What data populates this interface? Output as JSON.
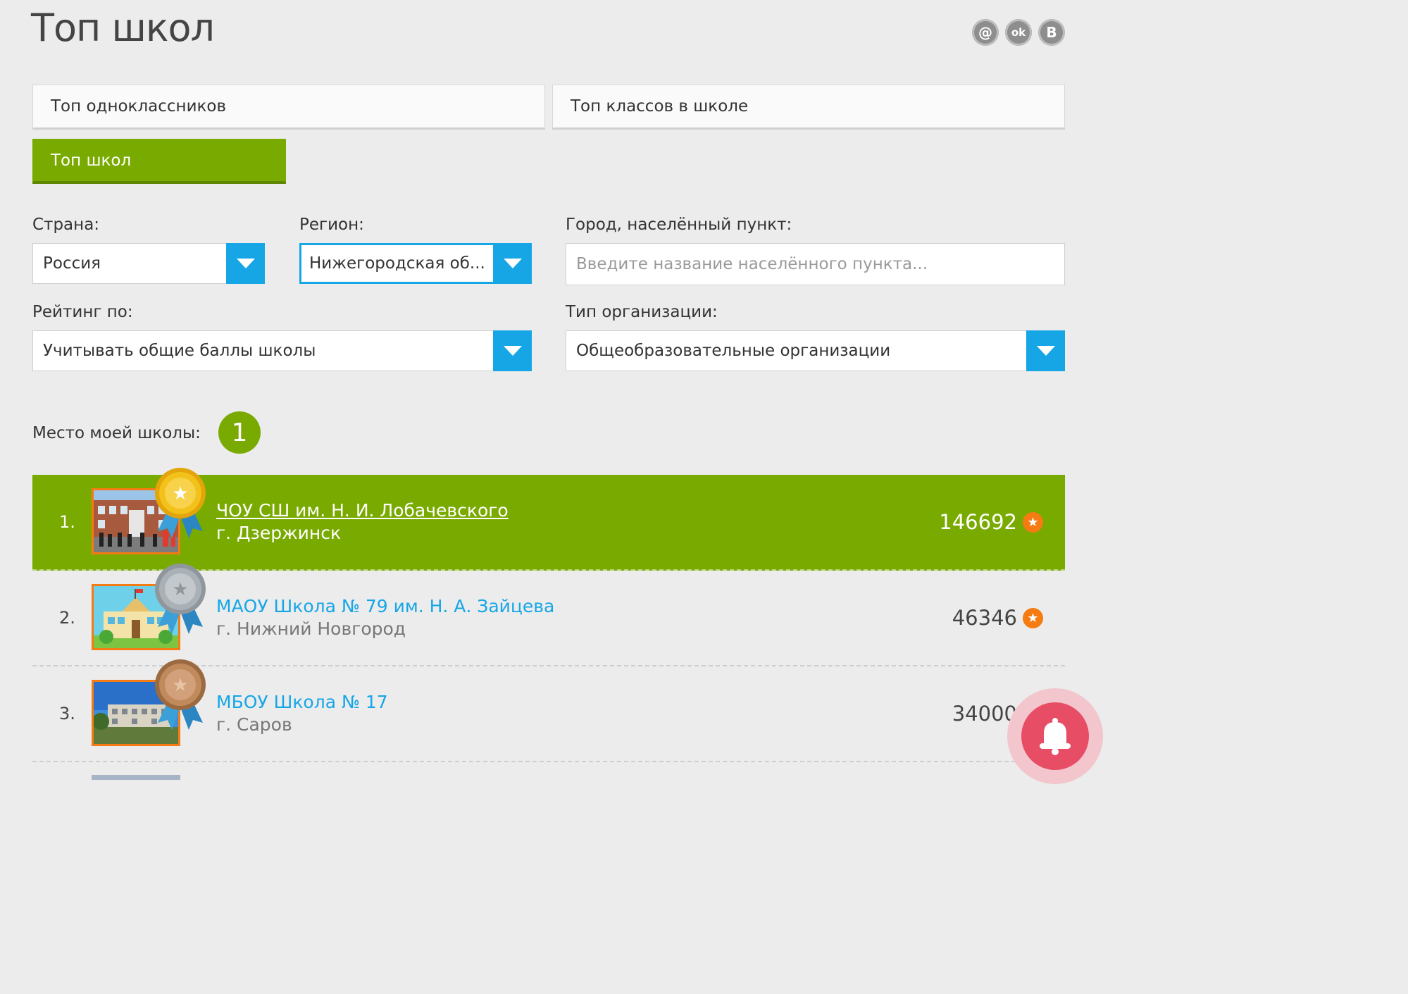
{
  "header": {
    "title": "Топ школ"
  },
  "social": [
    {
      "name": "mail-ru-icon",
      "glyph": "@"
    },
    {
      "name": "odnoklassniki-icon",
      "glyph": "ok"
    },
    {
      "name": "vkontakte-icon",
      "glyph": "В"
    }
  ],
  "tabs": {
    "classmates": "Топ одноклассников",
    "classes": "Топ классов в школе",
    "schools": "Топ школ"
  },
  "filters": {
    "country_label": "Страна:",
    "country_value": "Россия",
    "region_label": "Регион:",
    "region_value": "Нижегородская об...",
    "city_label": "Город, населённый пункт:",
    "city_placeholder": "Введите название населённого пункта...",
    "rating_label": "Рейтинг по:",
    "rating_value": "Учитывать общие баллы школы",
    "orgtype_label": "Тип организации:",
    "orgtype_value": "Общеобразовательные организации"
  },
  "my_school": {
    "label": "Место моей школы:",
    "rank": "1"
  },
  "schools": [
    {
      "pos": "1.",
      "name": "ЧОУ СШ им. Н. И. Лобачевского",
      "city": "г. Дзержинск",
      "score": "146692",
      "medal": "gold"
    },
    {
      "pos": "2.",
      "name": "МАОУ Школа № 79 им. Н. А. Зайцева",
      "city": "г. Нижний Новгород",
      "score": "46346",
      "medal": "silver"
    },
    {
      "pos": "3.",
      "name": "МБОУ Школа № 17",
      "city": "г. Саров",
      "score": "34000",
      "medal": "bronze"
    }
  ],
  "colors": {
    "accent_green": "#79aa00",
    "accent_blue": "#16a6e6",
    "score_orange": "#f57b12",
    "bell_red": "#e84d66",
    "gold": "#f2c21b",
    "silver": "#a9b1b7",
    "bronze": "#c08a5c"
  }
}
